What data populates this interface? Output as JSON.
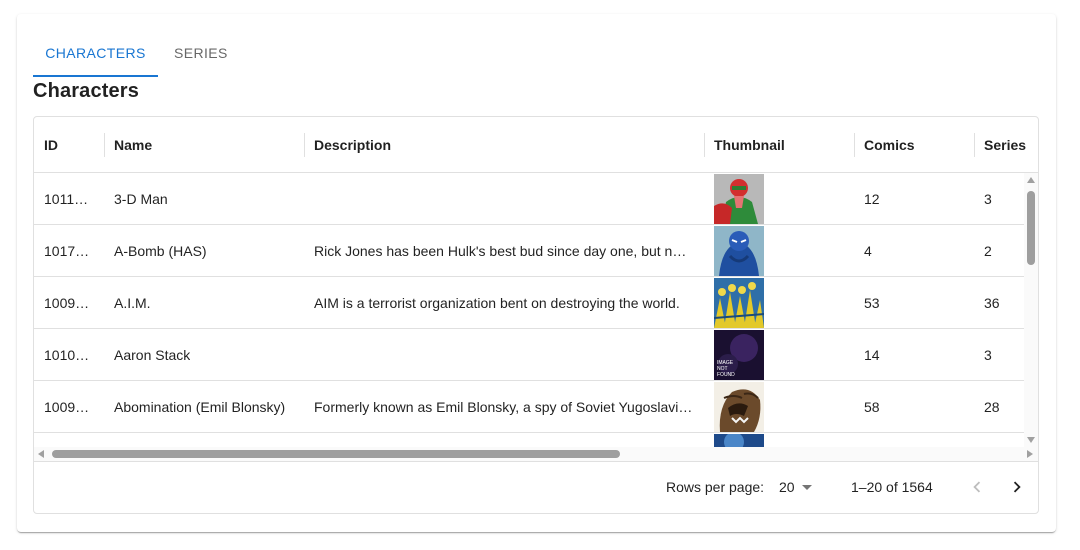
{
  "tabs": [
    {
      "label": "Characters",
      "active": true
    },
    {
      "label": "Series",
      "active": false
    }
  ],
  "section_title": "Characters",
  "table": {
    "columns": [
      "ID",
      "Name",
      "Description",
      "Thumbnail",
      "Comics",
      "Series"
    ],
    "rows": [
      {
        "id": "10113…",
        "name": "3-D Man",
        "description": "",
        "thumbnail": "3-D Man thumbnail",
        "comics": "12",
        "series": "3"
      },
      {
        "id": "10171…",
        "name": "A-Bomb (HAS)",
        "description": "Rick Jones has been Hulk's best bud since day one, but no…",
        "thumbnail": "A-Bomb thumbnail",
        "comics": "4",
        "series": "2"
      },
      {
        "id": "10091…",
        "name": "A.I.M.",
        "description": "AIM is a terrorist organization bent on destroying the world.",
        "thumbnail": "A.I.M. thumbnail",
        "comics": "53",
        "series": "36"
      },
      {
        "id": "10106…",
        "name": "Aaron Stack",
        "description": "",
        "thumbnail": "Image not found",
        "comics": "14",
        "series": "3"
      },
      {
        "id": "10091…",
        "name": "Abomination (Emil Blonsky)",
        "description": "Formerly known as Emil Blonsky, a spy of Soviet Yugoslavi…",
        "thumbnail": "Abomination thumbnail",
        "comics": "58",
        "series": "28"
      }
    ]
  },
  "pagination": {
    "rows_per_page_label": "Rows per page:",
    "rows_per_page_value": "20",
    "range_label": "1–20 of 1564"
  },
  "image_not_found_text": [
    "IMAGE",
    "NOT",
    "FOUND"
  ],
  "colors": {
    "accent": "#1976d2"
  }
}
